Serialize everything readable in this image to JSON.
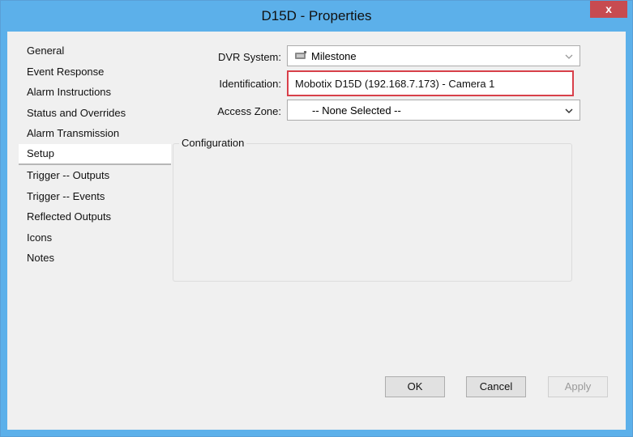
{
  "window": {
    "title": "D15D - Properties",
    "close_label": "x"
  },
  "sidebar": {
    "items": [
      {
        "label": "General"
      },
      {
        "label": "Event Response"
      },
      {
        "label": "Alarm Instructions"
      },
      {
        "label": "Status and Overrides"
      },
      {
        "label": "Alarm Transmission"
      },
      {
        "label": "Setup",
        "selected": true
      },
      {
        "label": "Trigger -- Outputs"
      },
      {
        "label": "Trigger -- Events"
      },
      {
        "label": "Reflected Outputs"
      },
      {
        "label": "Icons"
      },
      {
        "label": "Notes"
      }
    ]
  },
  "form": {
    "dvr_label": "DVR System:",
    "dvr_value": "Milestone",
    "dvr_icon": "dvr-device-icon",
    "ident_label": "Identification:",
    "ident_value": "Mobotix D15D (192.168.7.173) - Camera 1",
    "zone_label": "Access Zone:",
    "zone_value": "-- None Selected --",
    "config_label": "Configuration"
  },
  "buttons": {
    "ok": "OK",
    "cancel": "Cancel",
    "apply": "Apply"
  },
  "colors": {
    "titlebar": "#5cb0ea",
    "close": "#c74b50",
    "highlight_border": "#d8404a"
  }
}
